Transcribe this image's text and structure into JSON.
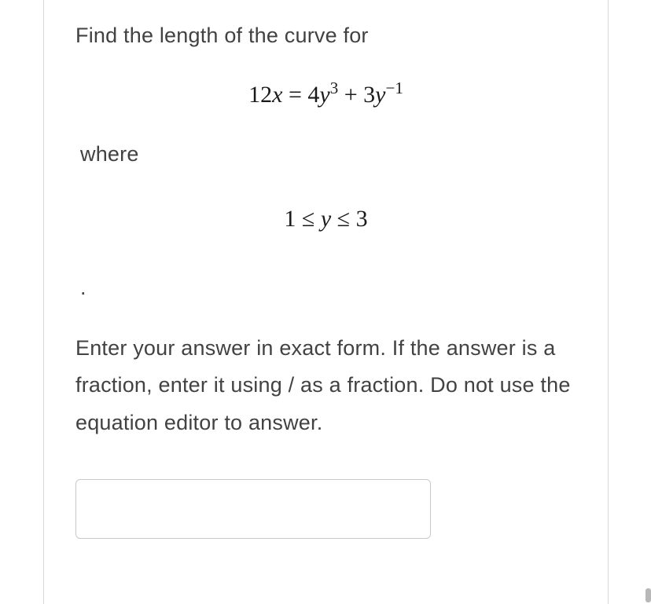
{
  "question": {
    "prompt": "Find the length of the curve for",
    "equation_html": "12<span class='italic'>x</span> = 4<span class='italic'>y</span><sup>3</sup> + 3<span class='italic'>y</span><sup>&minus;1</sup>",
    "where_label": "where",
    "range_html": "1 &le; <span class='italic'>y</span> &le; 3",
    "dot": ".",
    "instructions": "Enter your answer in exact form. If the answer is a fraction, enter it using / as a fraction. Do not use the equation editor to answer."
  },
  "answer": {
    "value": ""
  }
}
